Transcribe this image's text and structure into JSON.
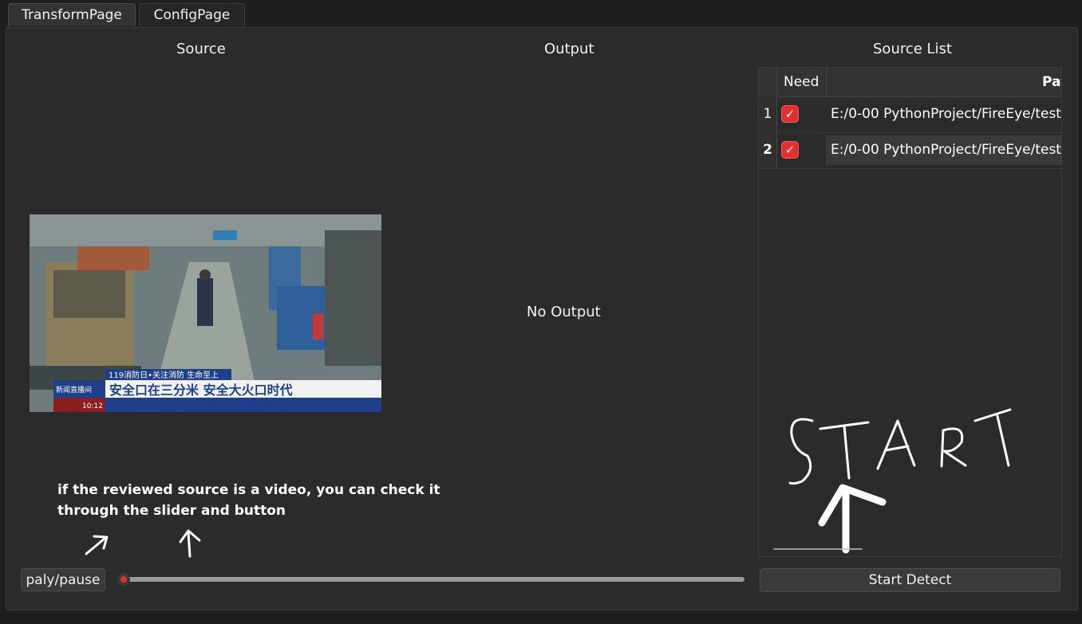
{
  "tabs": [
    {
      "label": "TransformPage",
      "active": true
    },
    {
      "label": "ConfigPage",
      "active": false
    }
  ],
  "headers": {
    "source": "Source",
    "output": "Output",
    "source_list": "Source List"
  },
  "output": {
    "empty_text": "No Output"
  },
  "preview": {
    "ticker_headline": "119消防日•关注消防 生命至上",
    "ticker_main": "安全口在三分米 安全大火口时代",
    "ticker_time": "10:12",
    "ticker_station": "新闻直播间"
  },
  "table": {
    "columns": {
      "need": "Need",
      "path": "Path"
    },
    "rows": [
      {
        "index": "1",
        "checked": true,
        "path": "E:/0-00 PythonProject/FireEye/test"
      },
      {
        "index": "2",
        "checked": true,
        "path": "E:/0-00 PythonProject/FireEye/test"
      }
    ]
  },
  "annotation": {
    "hint_line1": "if the reviewed source is a video, you can check it",
    "hint_line2": "through the slider and button",
    "start_text": "START"
  },
  "controls": {
    "play_pause_label": "paly/pause",
    "start_detect_label": "Start Detect",
    "slider_position": 0
  },
  "colors": {
    "accent": "#e03030",
    "panel": "#2b2b2b",
    "background": "#1e1e1e"
  }
}
